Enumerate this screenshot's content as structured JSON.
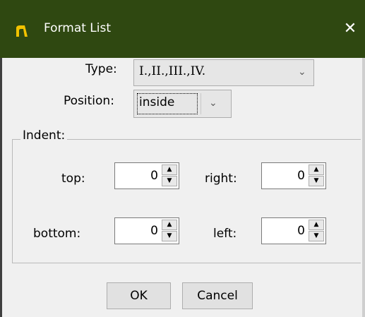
{
  "window": {
    "title": "Format List",
    "close_glyph": "✕",
    "icon": "app-icon"
  },
  "type": {
    "label": "Type:",
    "value": "I.,II.,III.,IV."
  },
  "position": {
    "label": "Position:",
    "value": "inside"
  },
  "indent": {
    "legend": "Indent:",
    "top": {
      "label": "top:",
      "value": "0"
    },
    "right": {
      "label": "right:",
      "value": "0"
    },
    "bottom": {
      "label": "bottom:",
      "value": "0"
    },
    "left": {
      "label": "left:",
      "value": "0"
    }
  },
  "buttons": {
    "ok": "OK",
    "cancel": "Cancel"
  },
  "colors": {
    "titlebar": "#2f4811",
    "dialog_bg": "#f0f0f0"
  }
}
